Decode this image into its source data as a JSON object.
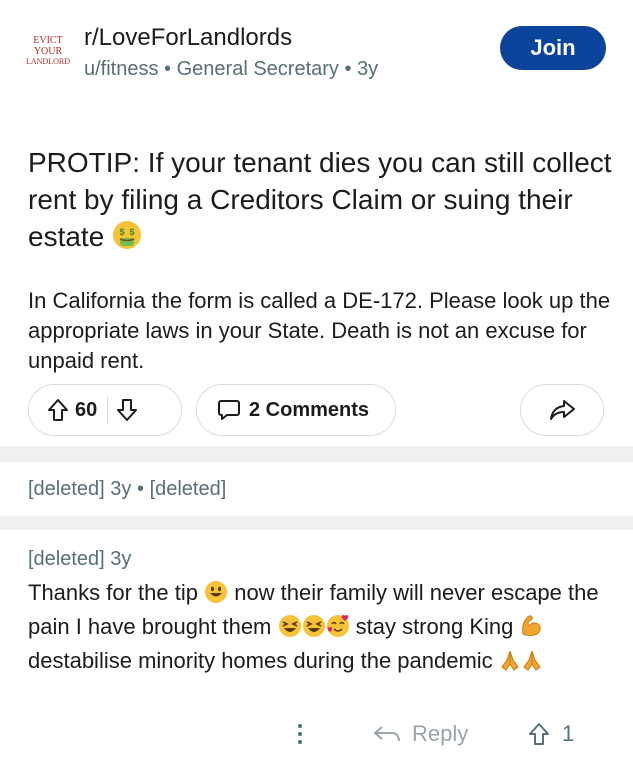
{
  "post": {
    "subreddit": "r/LoveForLandlords",
    "logo_text": [
      "EVICT",
      "YOUR",
      "LANDLORD"
    ],
    "author": "u/fitness",
    "flair": "General Secretary",
    "age": "3y",
    "separator": "•",
    "join_label": "Join",
    "title": "PROTIP: If your tenant dies you can still collect rent by filing a Creditors Claim or suing their estate",
    "body": "In California the form is called a DE-172. Please look up the appropriate laws in your State. Death is not an excuse for unpaid rent.",
    "votes": "60",
    "comments_label": "2 Comments"
  },
  "comments": [
    {
      "author": "[deleted]",
      "age": "3y",
      "body": "[deleted]"
    },
    {
      "author": "[deleted]",
      "age": "3y",
      "text_parts": [
        "Thanks for the tip ",
        " now their family will never escape the pain I have brought them ",
        " stay strong King ",
        " destabilise minority homes during the pandemic "
      ],
      "reply_label": "Reply",
      "votes": "1"
    }
  ],
  "icons": [
    "upvote-icon",
    "downvote-icon",
    "comment-icon",
    "share-icon",
    "more-icon",
    "reply-icon"
  ],
  "colors": {
    "join": "#0a449b",
    "meta": "#576f76",
    "gap": "#eef0f1",
    "border": "#d8dcde"
  }
}
